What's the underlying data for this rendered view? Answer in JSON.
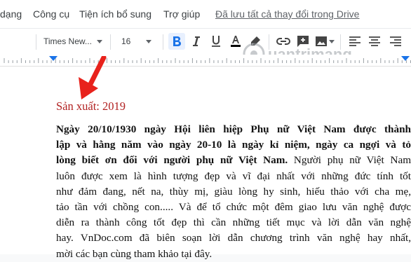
{
  "menubar": {
    "items": [
      "dạng",
      "Công cụ",
      "Tiện ích bổ sung",
      "Trợ giúp"
    ],
    "saved_status": "Đã lưu tất cả thay đổi trong Drive"
  },
  "toolbar": {
    "font_family": "Times New...",
    "font_size": "16",
    "buttons": [
      "bold-icon",
      "italic-icon",
      "underline-icon",
      "text-color-icon",
      "highlight-icon",
      "link-icon",
      "insert-comment-icon",
      "insert-image-icon",
      "align-left-icon",
      "align-center-icon"
    ]
  },
  "watermark": {
    "text": "uantrimang"
  },
  "document": {
    "heading": "Sản xuất: 2019",
    "heading_color": "#b22222",
    "lines": [
      {
        "text": "Ngày 20/10/1930 ngày Hội liên hiệp Phụ nữ Việt Nam được thành"
      },
      {
        "text": "lập và hằng năm vào ngày 20-10 là ngày kỉ niệm, ngày ca ngợi và tỏ"
      },
      {
        "bold": "lòng biết ơn đối với người phụ nữ Việt Nam.",
        "normal": " Người phụ nữ Việt Nam"
      },
      {
        "text": "luôn được xem là hình tượng đẹp và vĩ đại nhất với những đức tính tốt"
      },
      {
        "text": "như đảm đang, nết na, thùy mị, giàu lòng hy sinh, hiếu thảo với cha mẹ,"
      },
      {
        "text": "tảo tần với chồng con..... Và để tổ chức một đêm giao lưu văn nghệ được"
      },
      {
        "text": "diễn ra thành công tốt đẹp thì cần những tiết mục và lời dẫn văn nghệ"
      },
      {
        "text": "hay. VnDoc.com đã biên soạn lời dẫn chương trình văn nghệ hay nhất,"
      },
      {
        "text": "mời các bạn cùng tham khảo tại đây."
      }
    ]
  },
  "annotation": {
    "arrow_color": "#e8221c"
  }
}
